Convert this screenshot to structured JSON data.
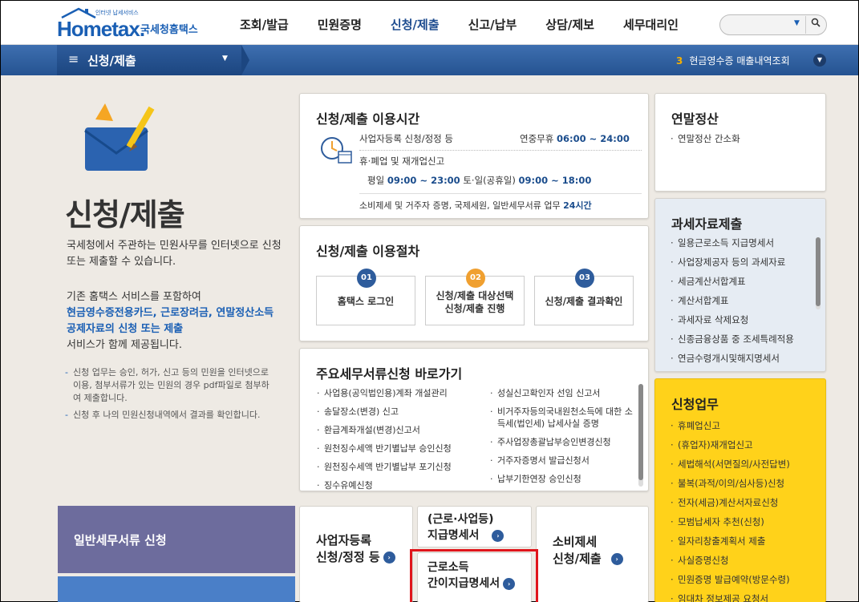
{
  "header": {
    "logo_text": "Hometax.",
    "logo_sub": "인터넷 납세서비스",
    "logo_kr": "국세청홈택스",
    "nav": [
      "조회/발급",
      "민원증명",
      "신청/제출",
      "신고/납부",
      "상담/제보",
      "세무대리인"
    ],
    "active_nav": "신청/제출",
    "search_placeholder": ""
  },
  "breadcrumb": {
    "title": "신청/제출",
    "right_num": "3",
    "right_text": "현금영수증 매출내역조회"
  },
  "intro": {
    "title": "신청/제출",
    "p1": "국세청에서 주관하는 민원사무를 인터넷으로 신청 또는 제출할 수 있습니다.",
    "p2_a": "기존 홈택스 서비스를 포함하여",
    "p2_blue": "현금영수증전용카드, 근로장려금, 연말정산소득공제자료의 신청 또는 제출",
    "p2_b": "서비스가 함께 제공됩니다.",
    "note1": "신청 업무는 승인, 허가, 신고 등의 민원을 인터넷으로 이용, 첨부서류가 있는 민원의 경우 pdf파일로 첨부하여 제출합니다.",
    "note2": "신청 후 나의 민원신청내역에서 결과를 확인합니다."
  },
  "left_buttons": {
    "general": "일반세무서류 신청"
  },
  "hours": {
    "title": "신청/제출 이용시간",
    "r1_label": "사업자등록 신청/정정 등",
    "r1_time_label": "연중무휴",
    "r1_time": "06:00 ~ 24:00",
    "r2": "휴·폐업 및 재개업신고",
    "r3_weekday": "평일",
    "r3_weekday_time": "09:00 ~ 23:00",
    "r3_weekend": "토·일(공휴일)",
    "r3_weekend_time": "09:00 ~ 18:00",
    "r4": "소비제세 및 거주자 증명, 국제세원, 일반세무서류 업무",
    "r4_time": "24시간"
  },
  "procedure": {
    "title": "신청/제출 이용절차",
    "steps": [
      {
        "num": "01",
        "label": "홈택스 로그인"
      },
      {
        "num": "02",
        "label_1": "신청/제출 대상선택",
        "label_2": "신청/제출 진행"
      },
      {
        "num": "03",
        "label": "신청/제출 결과확인"
      }
    ]
  },
  "shortcuts": {
    "title": "주요세무서류신청 바로가기",
    "col1": [
      "사업용(공익법인용)계좌 개설관리",
      "송달장소(변경) 신고",
      "환급계좌개설(변경)신고서",
      "원천징수세액 반기별납부 승인신청",
      "원천징수세액 반기별납부 포기신청",
      "징수유예신청"
    ],
    "col2": [
      "성실신고확인자 선임 신고서",
      "비거주자등의국내원천소득에 대한 소득세(법인세) 납세사실 증명",
      "주사업장총괄납부승인변경신청",
      "거주자증명서 발급신청서",
      "납부기한연장 승인신청"
    ]
  },
  "quick": {
    "biz_reg_1": "사업자등록",
    "biz_reg_2": "신청/정정 등",
    "labor_1": "(근로·사업등)",
    "labor_2": "지급명세서",
    "simple_1": "근로소득",
    "simple_2": "간이지급명세서",
    "consumption_1": "소비제세",
    "consumption_2": "신청/제출"
  },
  "year_end": {
    "title": "연말정산",
    "items": [
      "연말정산 간소화"
    ]
  },
  "tax_data": {
    "title": "과세자료제출",
    "items": [
      "일용근로소득 지급명세서",
      "사업장제공자 등의 과세자료",
      "세금계산서합계표",
      "계산서합계표",
      "과세자료 삭제요청",
      "신종금융상품 중 조세특례적용",
      "연금수령개시및해지명세서"
    ]
  },
  "application": {
    "title": "신청업무",
    "items": [
      "휴폐업신고",
      "(휴업자)재개업신고",
      "세법해석(서면질의/사전답변)",
      "불복(과적/이의/심사등)신청",
      "전자(세금)계산서자료신청",
      "모범납세자 추천(신청)",
      "일자리창출계획서 제출",
      "사실증명신청",
      "민원증명 발급예약(방문수령)",
      "임대차 정보제공 요청서"
    ]
  },
  "colors": {
    "brand_blue": "#1a5fb4",
    "bar_blue": "#2e5c9c",
    "application_yellow": "#ffd21a",
    "highlight_red": "#e0151c",
    "purple": "#6d6c9d"
  }
}
